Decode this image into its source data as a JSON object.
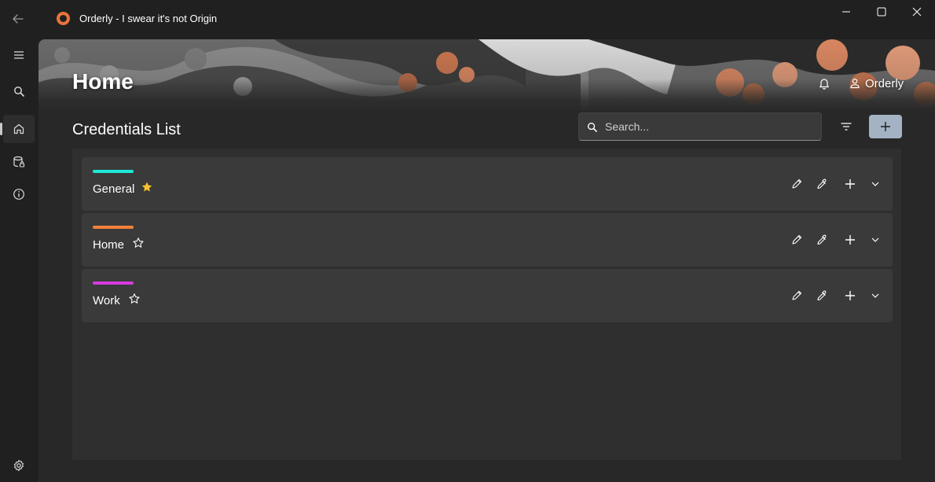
{
  "app": {
    "title": "Orderly - I swear it's not Origin",
    "accent": "#e8743b"
  },
  "titlebar": {
    "back_icon": "back-arrow-icon",
    "minimize_icon": "minimize-icon",
    "maximize_icon": "maximize-icon",
    "close_icon": "close-icon"
  },
  "sidebar": {
    "items": [
      {
        "name": "menu",
        "icon": "hamburger-icon"
      },
      {
        "name": "search",
        "icon": "search-icon"
      },
      {
        "name": "home",
        "icon": "home-icon",
        "active": true
      },
      {
        "name": "credentials",
        "icon": "database-lock-icon"
      },
      {
        "name": "about",
        "icon": "info-icon"
      },
      {
        "name": "settings",
        "icon": "gear-icon"
      }
    ]
  },
  "header": {
    "title": "Home",
    "user_name": "Orderly",
    "bell_icon": "bell-icon",
    "user_icon": "person-icon"
  },
  "list": {
    "title": "Credentials List",
    "search_placeholder": "Search...",
    "filter_icon": "filter-icon",
    "add_icon": "plus-icon",
    "items": [
      {
        "name": "General",
        "color": "#1de9d8",
        "favorite": true
      },
      {
        "name": "Home",
        "color": "#f2803a",
        "favorite": false
      },
      {
        "name": "Work",
        "color": "#d63be0",
        "favorite": false
      }
    ],
    "item_actions": [
      "pencil-icon",
      "eyedropper-icon",
      "plus-icon",
      "chevron-down-icon"
    ]
  }
}
